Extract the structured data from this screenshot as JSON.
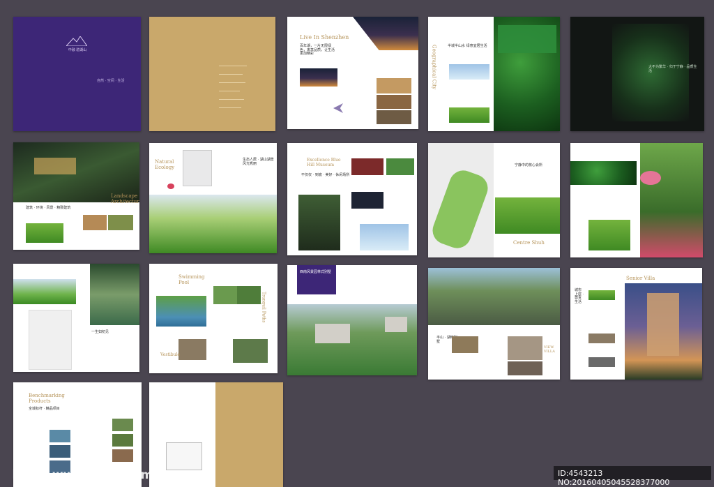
{
  "cover": {
    "subtitle_cn": "中融 碧湖山",
    "tagline_cn": "自然 · 空间 · 生活",
    "colors": {
      "purple": "#3d2677",
      "gold": "#c9a86b",
      "background": "#4a4550"
    }
  },
  "pages": {
    "live_in_shenzhen": {
      "title": "Live In Shenzhen",
      "lead_cn": "百年湖，一片无限绿色，来享品质，让生活更加精彩"
    },
    "geographical_city": {
      "vertical": "Geographical City",
      "lead_cn": "半城半山水 绿意宜居生活"
    },
    "night_cover": {
      "vertical_text_cn": "大不为繁华 · 归于宁静 · 品质生活"
    },
    "landscape": {
      "title": "Landscape Architecture",
      "lead_cn": "建筑 · 环境 · 风景 · 精致建筑"
    },
    "natural_ecology": {
      "title": "Natural Ecology",
      "lead_cn": "生态人居 · 湖山湖景 风光秀丽"
    },
    "museum": {
      "title": "Excellence Blue Hill Museum",
      "lead_cn": "不仅仅 · 到底 · 美好 · 休闲场所"
    },
    "centre_shuh": {
      "title": "Centre Shuh",
      "lead_cn": "宁静中的核心会所"
    },
    "page_lake": {
      "lead_cn": "一生如初见"
    },
    "swimming_pool": {
      "title": "Swimming Pool",
      "side": "Vestibule",
      "vertical": "Tranquil Paths"
    },
    "aerial": {
      "band_cn": "西南风景园林式别墅"
    },
    "villa": {
      "label": "VIEW VILLA",
      "lead_cn": "半山 · 湖畔别墅"
    },
    "senior_villa": {
      "title": "Senior Villa",
      "lead_cn": "城市上层 · 尊贵生活"
    },
    "benchmarking": {
      "title": "Benchmarking Products",
      "lead_cn": "全城标杆 · 精品项目"
    }
  },
  "watermark": {
    "site": "昵图网 www.nipic.com",
    "id": "ID:4543213 NO:20160405045528377000"
  }
}
